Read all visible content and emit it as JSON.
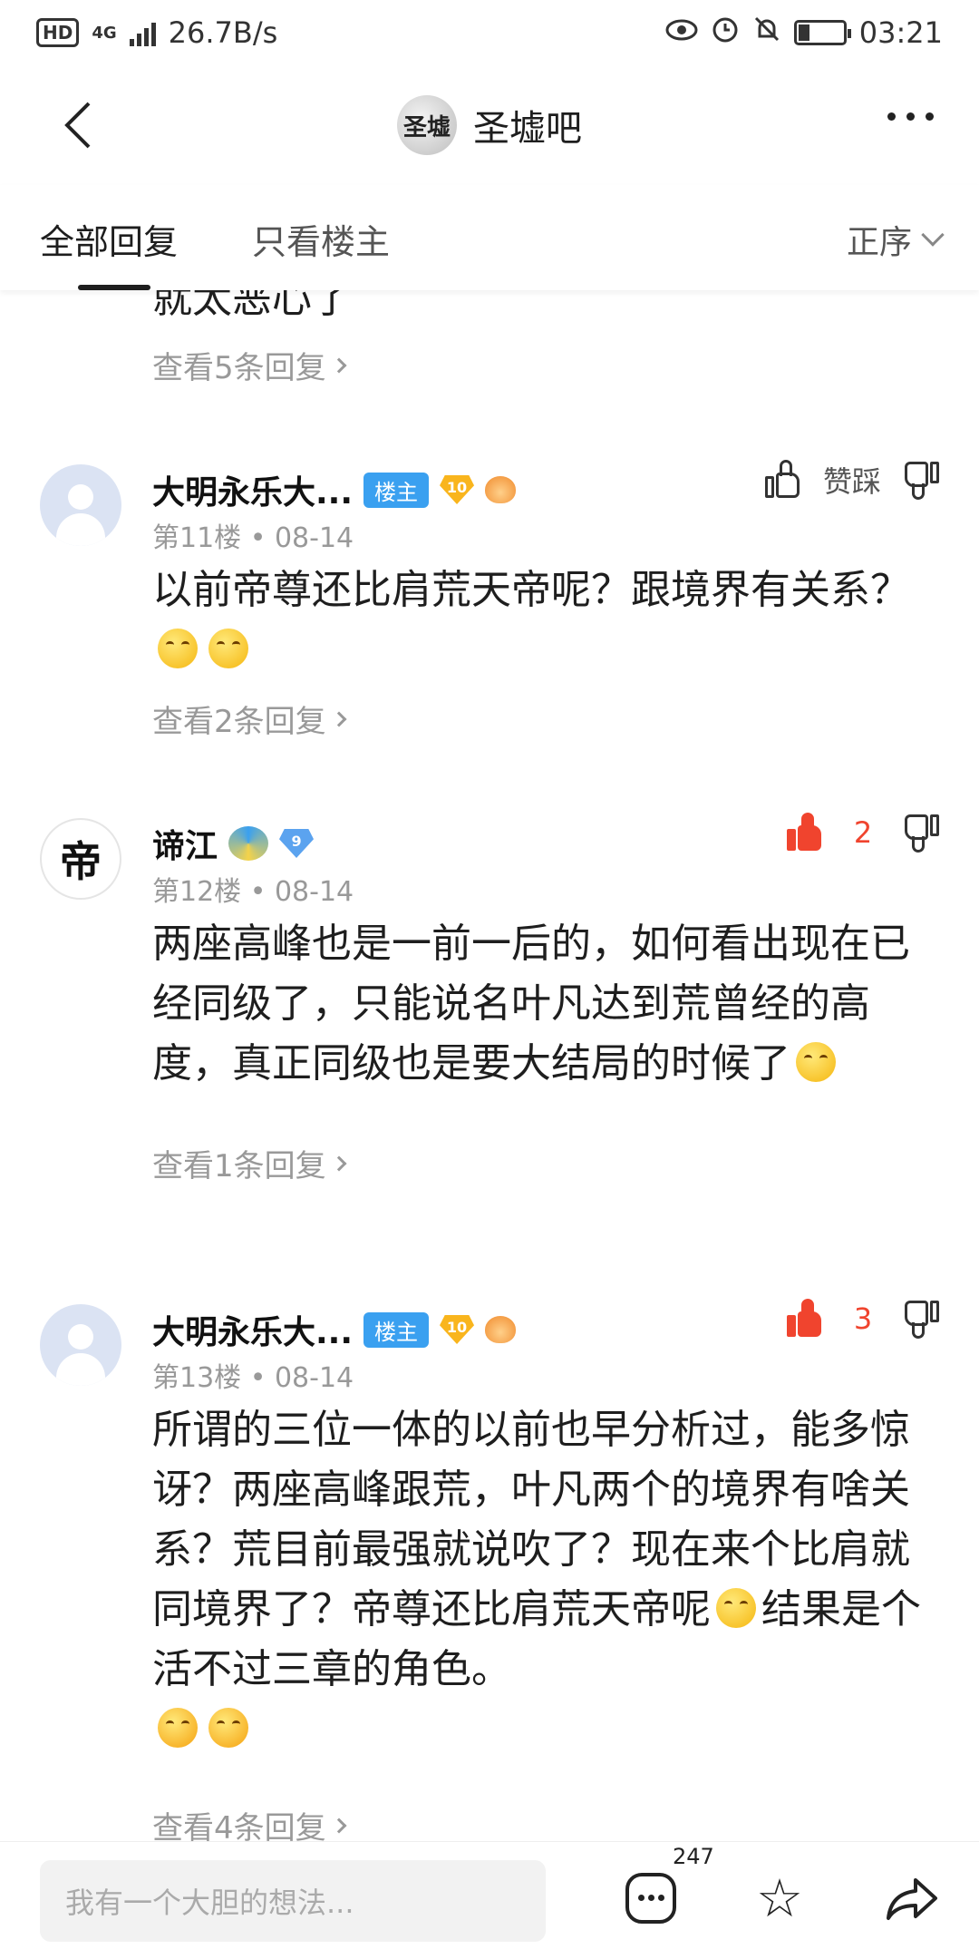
{
  "status_bar": {
    "hd": "HD",
    "network": "4G",
    "speed": "26.7B/s",
    "time": "03:21"
  },
  "nav": {
    "logo_text": "圣墟",
    "title": "圣墟吧"
  },
  "tabs": {
    "all": "全部回复",
    "op_only": "只看楼主",
    "order": "正序"
  },
  "feed": {
    "cut_text": "就太恶心了",
    "cut_replies": "查看5条回复",
    "posts": [
      {
        "name": "大明永乐大...",
        "badge": "楼主",
        "level": "10",
        "meta": "第11楼 • 08-14",
        "text": "以前帝尊还比肩荒天帝呢？跟境界有关系？",
        "vote_label": "赞踩",
        "likes": "",
        "replies": "查看2条回复"
      },
      {
        "name": "谛江",
        "avatar_char": "帝",
        "level": "9",
        "meta": "第12楼 • 08-14",
        "text": "两座高峰也是一前一后的，如何看出现在已经同级了，只能说名叶凡达到荒曾经的高度，真正同级也是要大结局的时候了",
        "likes": "2",
        "replies": "查看1条回复"
      },
      {
        "name": "大明永乐大...",
        "badge": "楼主",
        "level": "10",
        "meta": "第13楼 • 08-14",
        "text_a": "所谓的三位一体的以前也早分析过，能多惊讶？两座高峰跟荒，叶凡两个的境界有啥关系？荒目前最强就说吹了？现在来个比肩就同境界了？帝尊还比肩荒天帝呢",
        "text_b": "结果是个活不过三章的角色。",
        "likes": "3",
        "replies": "查看4条回复"
      }
    ]
  },
  "bottom": {
    "placeholder": "我有一个大胆的想法...",
    "comment_count": "247"
  }
}
